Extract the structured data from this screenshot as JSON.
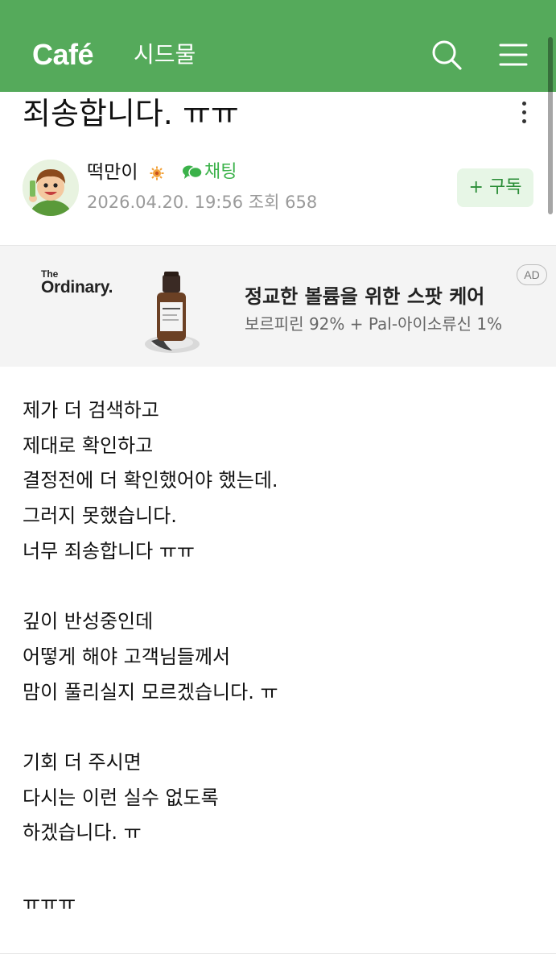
{
  "header": {
    "logo": "Café",
    "cafe_name": "시드물",
    "bg_color": "#55aa5b"
  },
  "post": {
    "title": "죄송합니다. ㅠㅠ",
    "author": "떡만이",
    "chat_label": "채팅",
    "date": "2026.04.20. 19:56",
    "views_label": "조회",
    "views": "658",
    "subscribe_label": "+ 구독"
  },
  "ad": {
    "brand_small": "The",
    "brand": "Ordinary.",
    "headline": "정교한 볼륨을 위한 스팟 케어",
    "subline": "보르피린 92% + Pal-아이소류신 1%",
    "label": "AD"
  },
  "content": {
    "lines": [
      "제가 더 검색하고",
      "제대로 확인하고",
      "결정전에 더 확인했어야 했는데.",
      "그러지 못했습니다.",
      "너무 죄송합니다 ㅠㅠ",
      "",
      "깊이 반성중인데",
      "어떻게 해야 고객님들께서",
      "맘이 풀리실지 모르겠습니다. ㅠ",
      "",
      "기회 더 주시면",
      "다시는 이런 실수 없도록",
      "하겠습니다. ㅠ",
      "",
      "ㅠㅠㅠ"
    ]
  },
  "icons": {
    "search": "search-icon",
    "menu": "menu-icon",
    "more": "more-vertical-icon",
    "chat": "chat-bubble-icon",
    "badge": "member-grade-icon",
    "avatar": "user-avatar"
  }
}
